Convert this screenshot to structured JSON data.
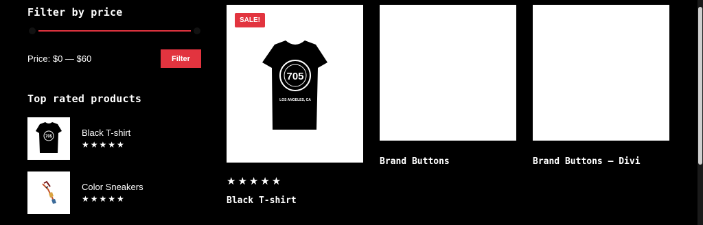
{
  "filter": {
    "title": "Filter by price",
    "price_text": "Price: $0 — $60",
    "button": "Filter",
    "range": {
      "min": 0,
      "max": 60
    }
  },
  "top_rated": {
    "title": "Top rated products",
    "items": [
      {
        "name": "Black T-shirt",
        "rating": 5,
        "stars": "★★★★★"
      },
      {
        "name": "Color Sneakers",
        "rating": 5,
        "stars": "★★★★★"
      }
    ]
  },
  "products": [
    {
      "name": "Black T-shirt",
      "badge": "SALE!",
      "rating": 5,
      "stars": "★★★★★",
      "image_text": "705",
      "image_subtext": "LOS ANGELES, CA"
    },
    {
      "name": "Brand Buttons"
    },
    {
      "name": "Brand Buttons – Divi"
    }
  ],
  "colors": {
    "accent": "#e2343f",
    "background": "#000000"
  }
}
